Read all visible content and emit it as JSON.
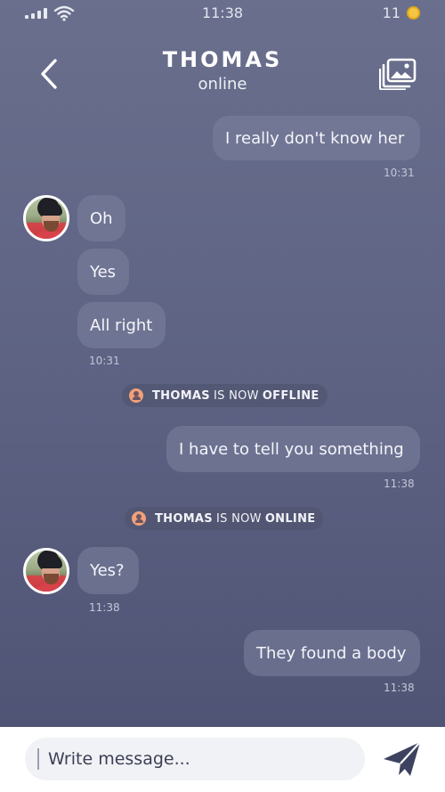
{
  "status_bar": {
    "time": "11:38",
    "battery": "11",
    "icons": [
      "signal-icon",
      "wifi-icon",
      "coin-icon"
    ]
  },
  "header": {
    "contact_name": "THOMAS",
    "contact_status": "online",
    "icons": [
      "chevron-left-icon",
      "gallery-icon"
    ]
  },
  "messages": [
    {
      "text": "I really don't know her",
      "time": "10:31"
    },
    {
      "text": "Oh"
    },
    {
      "text": "Yes"
    },
    {
      "text": "All right",
      "time": "10:31"
    },
    {
      "system": {
        "name": "THOMAS",
        "mid": "IS NOW",
        "state": "OFFLINE"
      }
    },
    {
      "text": "I have to tell you something",
      "time": "11:38"
    },
    {
      "system": {
        "name": "THOMAS",
        "mid": "IS NOW",
        "state": "ONLINE"
      }
    },
    {
      "text": "Yes?",
      "time": "11:38"
    },
    {
      "text": "They found a body",
      "time": "11:38"
    }
  ],
  "composer": {
    "placeholder": "Write message...",
    "value": "",
    "send_icon": "send-icon"
  },
  "colors": {
    "background_top": "#6a6f8d",
    "background_bottom": "#4d5172",
    "bubble": "#7a7f9c",
    "status_icon": "#f0a07a",
    "send": "#3d4260"
  }
}
